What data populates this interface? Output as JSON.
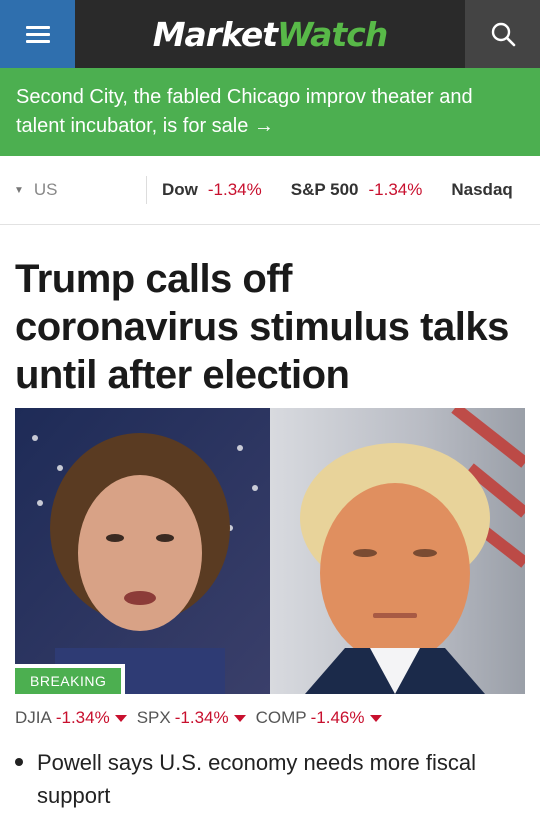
{
  "header": {
    "logo_part1": "Market",
    "logo_part2": "Watch",
    "menu_icon": "hamburger-menu-icon",
    "search_icon": "search-icon"
  },
  "banner": {
    "text": "Second City, the fabled Chicago improv theater and talent incubator, is for sale →"
  },
  "ticker": {
    "region": "US",
    "items": [
      {
        "name": "Dow",
        "change": "-1.34%"
      },
      {
        "name": "S&P 500",
        "change": "-1.34%"
      },
      {
        "name": "Nasdaq",
        "change": ""
      }
    ]
  },
  "article": {
    "headline": "Trump calls off coronavirus stimulus talks until after election",
    "badge": "BREAKING",
    "markets": [
      {
        "name": "DJIA",
        "change": "-1.34%"
      },
      {
        "name": "SPX",
        "change": "-1.34%"
      },
      {
        "name": "COMP",
        "change": "-1.46%"
      }
    ],
    "related": [
      {
        "text": "Powell says U.S. economy needs more fiscal support"
      }
    ]
  },
  "colors": {
    "accent_green": "#4caf50",
    "menu_blue": "#2f6fae",
    "negative_red": "#c8102e"
  }
}
